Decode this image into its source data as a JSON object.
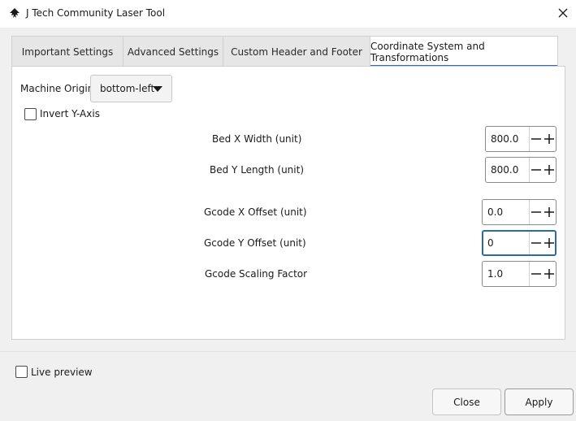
{
  "window": {
    "title": "J Tech Community Laser Tool",
    "app_icon": "inkscape-icon",
    "close_icon": "close-icon"
  },
  "tabs": [
    {
      "label": "Important Settings",
      "active": false
    },
    {
      "label": "Advanced Settings",
      "active": false
    },
    {
      "label": "Custom Header and Footer",
      "active": false
    },
    {
      "label": "Coordinate System and Transformations",
      "active": true
    }
  ],
  "coord": {
    "machine_origin_label": "Machine Origin",
    "machine_origin_value": "bottom-left",
    "invert_y_label": "Invert Y-Axis",
    "invert_y_checked": false,
    "fields": [
      {
        "label": "Bed X Width (unit)",
        "value": "800.0"
      },
      {
        "label": "Bed Y Length (unit)",
        "value": "800.0"
      },
      {
        "label": "Gcode X Offset (unit)",
        "value": "0.0"
      },
      {
        "label": "Gcode Y Offset (unit)",
        "value": "0"
      },
      {
        "label": "Gcode Scaling Factor",
        "value": "1.0"
      }
    ]
  },
  "footer": {
    "live_preview_label": "Live preview",
    "live_preview_checked": false,
    "close_label": "Close",
    "apply_label": "Apply"
  },
  "colors": {
    "accent": "#2d6fb5",
    "focus_border": "#2a6aa8",
    "background": "#f0f0f0"
  }
}
